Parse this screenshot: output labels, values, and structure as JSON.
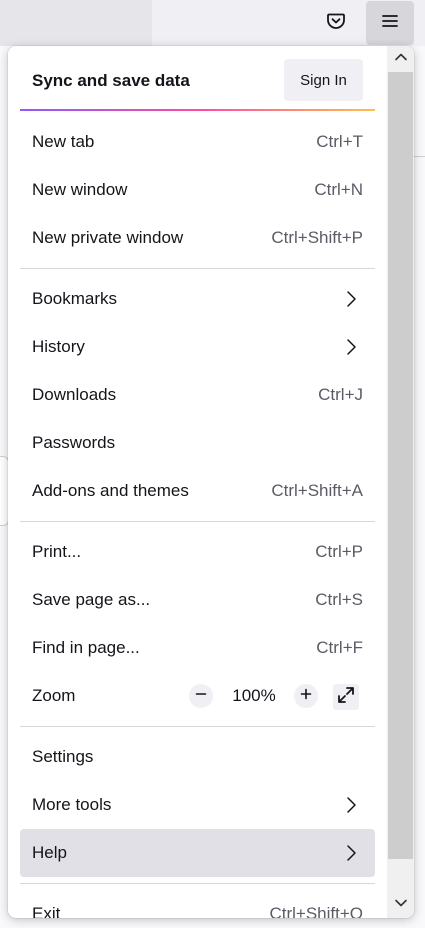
{
  "toolbar": {
    "pocket_icon": "pocket-icon",
    "menu_icon": "hamburger-menu-icon"
  },
  "sync": {
    "title": "Sync and save data",
    "sign_in_label": "Sign In"
  },
  "menu": {
    "new_tab": {
      "label": "New tab",
      "shortcut": "Ctrl+T"
    },
    "new_window": {
      "label": "New window",
      "shortcut": "Ctrl+N"
    },
    "new_private_window": {
      "label": "New private window",
      "shortcut": "Ctrl+Shift+P"
    },
    "bookmarks": {
      "label": "Bookmarks"
    },
    "history": {
      "label": "History"
    },
    "downloads": {
      "label": "Downloads",
      "shortcut": "Ctrl+J"
    },
    "passwords": {
      "label": "Passwords"
    },
    "addons": {
      "label": "Add-ons and themes",
      "shortcut": "Ctrl+Shift+A"
    },
    "print": {
      "label": "Print...",
      "shortcut": "Ctrl+P"
    },
    "save_page": {
      "label": "Save page as...",
      "shortcut": "Ctrl+S"
    },
    "find": {
      "label": "Find in page...",
      "shortcut": "Ctrl+F"
    },
    "zoom": {
      "label": "Zoom",
      "value": "100%"
    },
    "settings": {
      "label": "Settings"
    },
    "more_tools": {
      "label": "More tools"
    },
    "help": {
      "label": "Help"
    },
    "exit": {
      "label": "Exit",
      "shortcut": "Ctrl+Shift+Q"
    }
  },
  "colors": {
    "hover_background": "#e0e0e6",
    "separator": "#d7d7db",
    "sync_gradient": [
      "#9059ff",
      "#ff4aa2",
      "#ffbd4f"
    ]
  }
}
